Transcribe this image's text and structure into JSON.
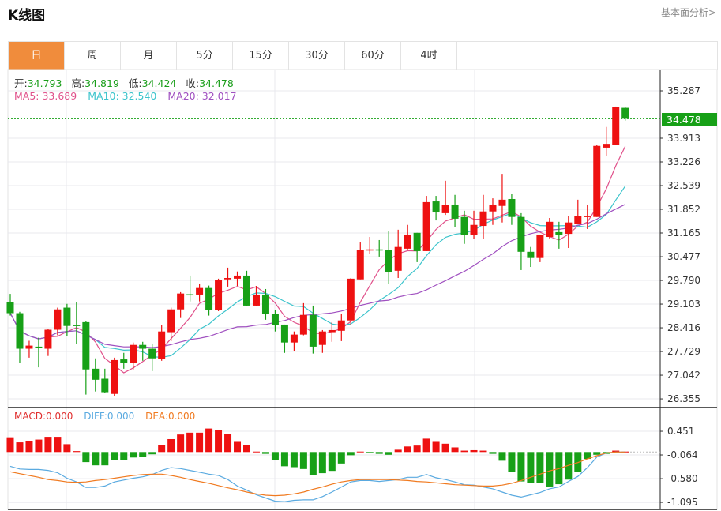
{
  "header": {
    "title": "K线图",
    "link": "基本面分析>"
  },
  "tabs": [
    {
      "label": "日",
      "active": true
    },
    {
      "label": "周"
    },
    {
      "label": "月"
    },
    {
      "label": "5分"
    },
    {
      "label": "15分"
    },
    {
      "label": "30分"
    },
    {
      "label": "60分"
    },
    {
      "label": "4时"
    }
  ],
  "ohlc": {
    "open_label": "开:",
    "open": "34.793",
    "high_label": "高:",
    "high": "34.819",
    "low_label": "低:",
    "low": "34.424",
    "close_label": "收:",
    "close": "34.478"
  },
  "ma": {
    "ma5": "MA5: 33.689",
    "ma10": "MA10: 32.540",
    "ma20": "MA20: 32.017"
  },
  "macd_legend": {
    "macd": "MACD:0.000",
    "diff": "DIFF:0.000",
    "dea": "DEA:0.000"
  },
  "current_price": "34.478",
  "colors": {
    "up": "#ee1111",
    "down": "#17a017",
    "ma5": "#e0508a",
    "ma10": "#3cc4cc",
    "ma20": "#a050c0",
    "diff": "#5aaae0",
    "dea": "#f07a20",
    "accent": "#f08c3c"
  },
  "chart_data": [
    {
      "type": "candlestick",
      "price_ticks": [
        "35.287",
        "33.913",
        "33.226",
        "32.539",
        "31.852",
        "31.165",
        "30.477",
        "29.790",
        "29.103",
        "28.416",
        "27.729",
        "27.042",
        "26.355"
      ],
      "ylim": [
        26.355,
        35.287
      ],
      "candles": [
        [
          29.17,
          28.84,
          29.4,
          28.77
        ],
        [
          28.84,
          27.81,
          28.88,
          27.39
        ],
        [
          27.81,
          27.9,
          28.04,
          27.55
        ],
        [
          27.87,
          27.83,
          28.13,
          27.27
        ],
        [
          27.81,
          28.36,
          28.38,
          27.6
        ],
        [
          28.36,
          28.95,
          29.0,
          28.2
        ],
        [
          29.0,
          28.47,
          29.11,
          28.18
        ],
        [
          28.5,
          28.49,
          29.17,
          27.94
        ],
        [
          28.58,
          27.21,
          28.61,
          26.48
        ],
        [
          27.23,
          26.91,
          27.53,
          26.57
        ],
        [
          26.94,
          26.55,
          27.23,
          26.53
        ],
        [
          26.5,
          27.48,
          27.55,
          26.43
        ],
        [
          27.5,
          27.41,
          27.69,
          27.23
        ],
        [
          27.39,
          27.92,
          27.99,
          27.21
        ],
        [
          27.92,
          27.81,
          28.01,
          27.46
        ],
        [
          27.81,
          27.53,
          27.96,
          27.16
        ],
        [
          27.51,
          28.31,
          28.49,
          27.46
        ],
        [
          28.29,
          28.95,
          29.0,
          28.03
        ],
        [
          28.95,
          29.41,
          29.45,
          28.7
        ],
        [
          29.39,
          29.38,
          29.93,
          29.18
        ],
        [
          29.38,
          29.57,
          29.7,
          29.18
        ],
        [
          29.57,
          28.93,
          29.64,
          28.77
        ],
        [
          28.93,
          29.8,
          29.84,
          28.9
        ],
        [
          29.82,
          29.86,
          30.16,
          29.61
        ],
        [
          29.84,
          29.93,
          30.05,
          29.63
        ],
        [
          29.93,
          29.06,
          30.07,
          29.04
        ],
        [
          29.06,
          29.38,
          29.63,
          29.04
        ],
        [
          29.38,
          28.81,
          29.54,
          28.65
        ],
        [
          28.81,
          28.49,
          28.93,
          28.31
        ],
        [
          28.51,
          27.99,
          28.51,
          27.69
        ],
        [
          27.99,
          28.22,
          28.31,
          27.73
        ],
        [
          28.22,
          28.79,
          29.13,
          28.2
        ],
        [
          28.79,
          27.87,
          29.06,
          27.67
        ],
        [
          27.92,
          28.31,
          28.35,
          27.69
        ],
        [
          28.29,
          28.35,
          28.58,
          28.01
        ],
        [
          28.33,
          28.63,
          28.83,
          28.03
        ],
        [
          28.63,
          29.84,
          29.86,
          28.49
        ],
        [
          29.82,
          30.67,
          30.89,
          29.82
        ],
        [
          30.67,
          30.69,
          31.05,
          30.55
        ],
        [
          30.69,
          30.67,
          30.96,
          30.48
        ],
        [
          30.67,
          30.02,
          31.21,
          29.68
        ],
        [
          30.07,
          30.76,
          31.26,
          29.86
        ],
        [
          30.71,
          31.12,
          31.4,
          30.69
        ],
        [
          31.17,
          30.64,
          31.17,
          30.32
        ],
        [
          30.64,
          32.06,
          32.24,
          30.64
        ],
        [
          32.08,
          31.76,
          32.24,
          31.53
        ],
        [
          31.74,
          31.97,
          32.68,
          31.69
        ],
        [
          31.99,
          31.58,
          32.27,
          31.33
        ],
        [
          31.63,
          31.1,
          31.81,
          30.85
        ],
        [
          31.1,
          31.4,
          31.81,
          30.99
        ],
        [
          31.37,
          31.79,
          32.27,
          30.99
        ],
        [
          31.79,
          31.99,
          32.17,
          31.4
        ],
        [
          31.95,
          32.13,
          32.88,
          31.47
        ],
        [
          32.15,
          31.63,
          32.29,
          31.4
        ],
        [
          31.63,
          30.62,
          31.74,
          30.09
        ],
        [
          30.62,
          30.44,
          30.76,
          30.18
        ],
        [
          30.44,
          31.12,
          31.12,
          30.32
        ],
        [
          31.05,
          31.49,
          31.6,
          31.01
        ],
        [
          31.19,
          31.12,
          31.49,
          30.71
        ],
        [
          31.14,
          31.47,
          31.65,
          30.73
        ],
        [
          31.44,
          31.65,
          32.13,
          31.44
        ],
        [
          31.65,
          31.66,
          31.99,
          31.28
        ],
        [
          31.63,
          33.69,
          33.71,
          31.63
        ],
        [
          33.64,
          33.75,
          34.24,
          33.41
        ],
        [
          33.73,
          34.81,
          34.83,
          33.73
        ],
        [
          34.793,
          34.478,
          34.819,
          34.424
        ]
      ],
      "series": [
        "MA5",
        "MA10",
        "MA20"
      ]
    },
    {
      "type": "macd",
      "ticks": [
        "0.451",
        "-0.064",
        "-0.580",
        "-1.095"
      ],
      "ylim": [
        -1.095,
        0.451
      ],
      "histogram": [
        0.32,
        0.21,
        0.23,
        0.27,
        0.33,
        0.33,
        0.17,
        0.02,
        -0.22,
        -0.29,
        -0.29,
        -0.18,
        -0.18,
        -0.12,
        -0.11,
        -0.05,
        0.15,
        0.28,
        0.38,
        0.42,
        0.42,
        0.51,
        0.48,
        0.39,
        0.22,
        0.15,
        0.01,
        -0.04,
        -0.18,
        -0.31,
        -0.33,
        -0.37,
        -0.5,
        -0.46,
        -0.41,
        -0.25,
        -0.07,
        0.01,
        -0.01,
        -0.04,
        -0.06,
        0.05,
        0.12,
        0.14,
        0.29,
        0.22,
        0.18,
        0.1,
        0.03,
        0.04,
        0.03,
        -0.04,
        -0.19,
        -0.43,
        -0.64,
        -0.68,
        -0.67,
        -0.75,
        -0.7,
        -0.6,
        -0.44,
        -0.15,
        -0.06,
        -0.04,
        0.03,
        0.01
      ],
      "diff": [
        -0.31,
        -0.37,
        -0.38,
        -0.38,
        -0.4,
        -0.45,
        -0.57,
        -0.65,
        -0.77,
        -0.77,
        -0.74,
        -0.65,
        -0.61,
        -0.57,
        -0.54,
        -0.49,
        -0.4,
        -0.34,
        -0.36,
        -0.4,
        -0.44,
        -0.48,
        -0.51,
        -0.6,
        -0.74,
        -0.83,
        -0.93,
        -1.0,
        -1.07,
        -1.08,
        -1.05,
        -1.04,
        -1.04,
        -0.97,
        -0.87,
        -0.76,
        -0.65,
        -0.62,
        -0.62,
        -0.64,
        -0.62,
        -0.6,
        -0.55,
        -0.55,
        -0.49,
        -0.56,
        -0.6,
        -0.65,
        -0.71,
        -0.72,
        -0.76,
        -0.8,
        -0.87,
        -0.94,
        -0.98,
        -0.93,
        -0.88,
        -0.8,
        -0.76,
        -0.64,
        -0.53,
        -0.34,
        -0.11,
        -0.02,
        0.0,
        0.0
      ],
      "dea": [
        -0.43,
        -0.47,
        -0.51,
        -0.55,
        -0.6,
        -0.62,
        -0.65,
        -0.66,
        -0.65,
        -0.62,
        -0.6,
        -0.57,
        -0.54,
        -0.51,
        -0.49,
        -0.48,
        -0.48,
        -0.51,
        -0.55,
        -0.6,
        -0.64,
        -0.68,
        -0.73,
        -0.78,
        -0.82,
        -0.87,
        -0.91,
        -0.94,
        -0.95,
        -0.94,
        -0.91,
        -0.87,
        -0.81,
        -0.76,
        -0.7,
        -0.65,
        -0.62,
        -0.6,
        -0.6,
        -0.6,
        -0.6,
        -0.61,
        -0.62,
        -0.64,
        -0.65,
        -0.67,
        -0.69,
        -0.71,
        -0.72,
        -0.73,
        -0.74,
        -0.74,
        -0.72,
        -0.68,
        -0.62,
        -0.55,
        -0.48,
        -0.41,
        -0.36,
        -0.29,
        -0.23,
        -0.15,
        -0.08,
        -0.02,
        0.0,
        0.0
      ]
    }
  ]
}
